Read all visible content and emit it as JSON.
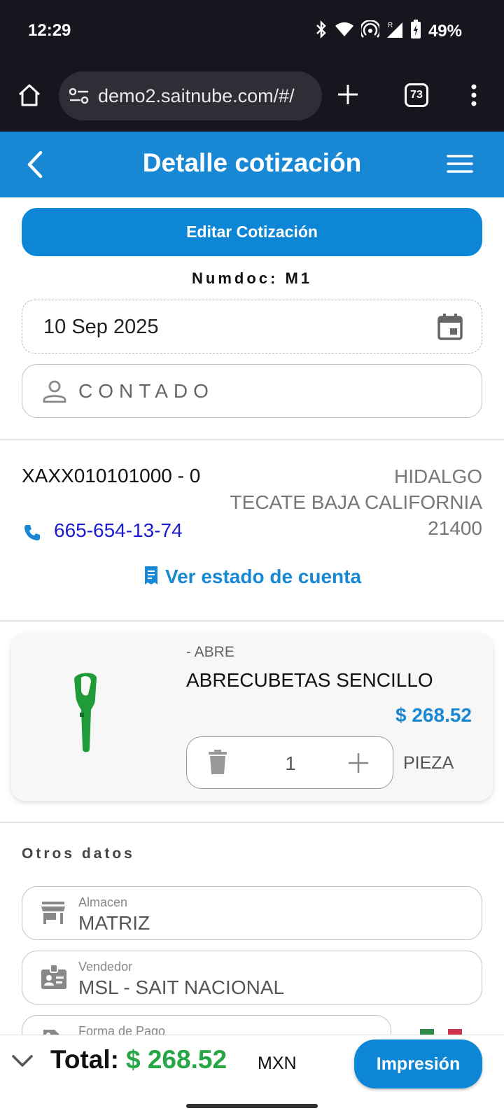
{
  "status_bar": {
    "time": "12:29",
    "battery": "49%"
  },
  "browser": {
    "url": "demo2.saitnube.com/#/",
    "tab_count": "73"
  },
  "header": {
    "title": "Detalle cotización"
  },
  "actions": {
    "edit_label": "Editar Cotización"
  },
  "document": {
    "numdoc": "Numdoc: M1",
    "date": "10 Sep 2025",
    "client": "CONTADO"
  },
  "customer": {
    "rfc": "XAXX010101000 - 0",
    "phone": "665-654-13-74",
    "address_line1": "HIDALGO",
    "address_line2": "TECATE BAJA CALIFORNIA",
    "address_line3": "21400",
    "account_link": "Ver estado de cuenta"
  },
  "product": {
    "code": "- ABRE",
    "name": "ABRECUBETAS SENCILLO",
    "price": "$ 268.52",
    "quantity": "1",
    "unit": "PIEZA"
  },
  "other_data": {
    "title": "Otros datos",
    "warehouse_label": "Almacen",
    "warehouse_value": "MATRIZ",
    "seller_label": "Vendedor",
    "seller_value": "MSL - SAIT NACIONAL",
    "payment_label": "Forma de Pago"
  },
  "footer": {
    "total_label": "Total:",
    "total_value": "$ 268.52",
    "currency": "MXN",
    "print_label": "Impresión"
  },
  "colors": {
    "accent": "#1888d4",
    "total_green": "#27a645"
  }
}
